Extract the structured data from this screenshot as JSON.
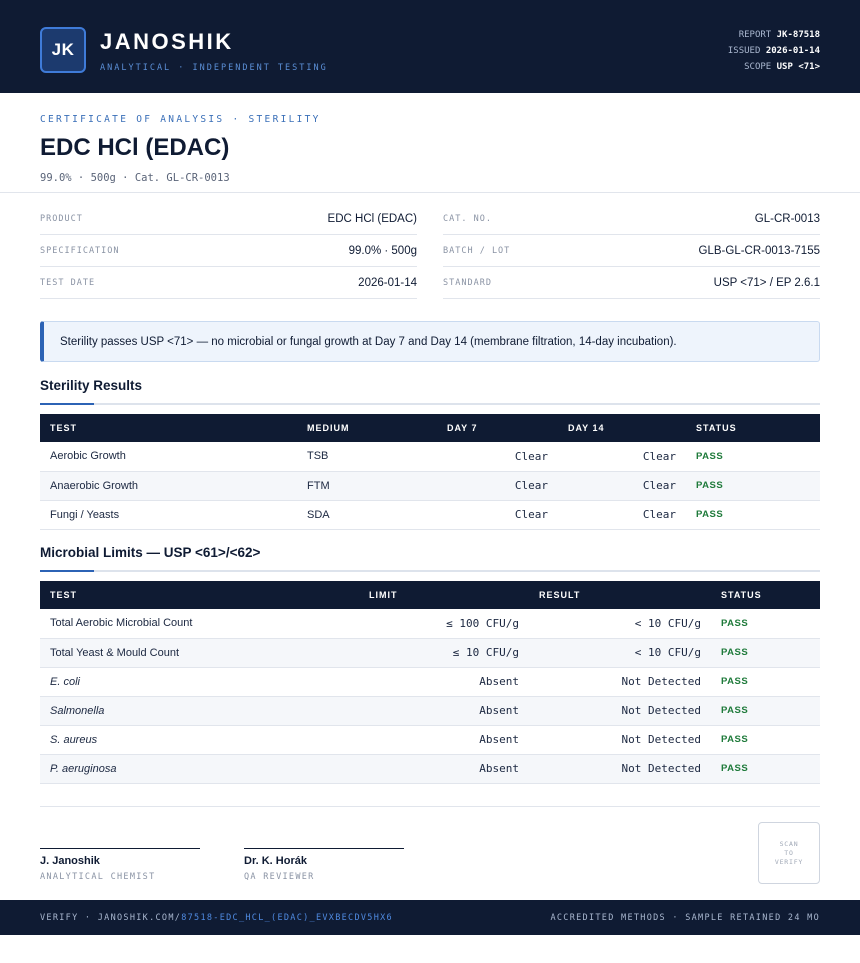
{
  "header": {
    "logo_text": "JK",
    "brand": "JANOSHIK",
    "tagline": "ANALYTICAL · INDEPENDENT TESTING",
    "report_label": "REPORT",
    "report_value": "JK-87518",
    "issued_label": "ISSUED",
    "issued_value": "2026-01-14",
    "scope_label": "SCOPE",
    "scope_value": "USP <71>"
  },
  "doc": {
    "kicker": "CERTIFICATE OF ANALYSIS · STERILITY",
    "title": "EDC HCl (EDAC)",
    "subtitle": "99.0% · 500g  ·  Cat. GL-CR-0013"
  },
  "info": {
    "left": [
      {
        "label": "PRODUCT",
        "value": "EDC HCl (EDAC)"
      },
      {
        "label": "SPECIFICATION",
        "value": "99.0% · 500g"
      },
      {
        "label": "TEST DATE",
        "value": "2026-01-14"
      }
    ],
    "right": [
      {
        "label": "CAT. NO.",
        "value": "GL-CR-0013"
      },
      {
        "label": "BATCH / LOT",
        "value": "GLB-GL-CR-0013-7155"
      },
      {
        "label": "STANDARD",
        "value": "USP <71> / EP 2.6.1"
      }
    ]
  },
  "callout": "Sterility passes USP <71> — no microbial or fungal growth at Day 7 and Day 14 (membrane filtration, 14-day incubation).",
  "sterility": {
    "title": "Sterility Results",
    "headers": [
      "TEST",
      "MEDIUM",
      "DAY 7",
      "DAY 14",
      "STATUS"
    ],
    "rows": [
      {
        "test": "Aerobic Growth",
        "medium": "TSB",
        "day7": "Clear",
        "day14": "Clear",
        "status": "PASS"
      },
      {
        "test": "Anaerobic Growth",
        "medium": "FTM",
        "day7": "Clear",
        "day14": "Clear",
        "status": "PASS"
      },
      {
        "test": "Fungi / Yeasts",
        "medium": "SDA",
        "day7": "Clear",
        "day14": "Clear",
        "status": "PASS"
      }
    ]
  },
  "microbial": {
    "title": "Microbial Limits — USP <61>/<62>",
    "headers": [
      "TEST",
      "LIMIT",
      "RESULT",
      "STATUS"
    ],
    "rows": [
      {
        "test": "Total Aerobic Microbial Count",
        "limit": "≤ 100 CFU/g",
        "result": "< 10 CFU/g",
        "status": "PASS"
      },
      {
        "test": "Total Yeast & Mould Count",
        "limit": "≤ 10 CFU/g",
        "result": "< 10 CFU/g",
        "status": "PASS"
      },
      {
        "test": "E. coli",
        "limit": "Absent",
        "result": "Not Detected",
        "status": "PASS"
      },
      {
        "test": "Salmonella",
        "limit": "Absent",
        "result": "Not Detected",
        "status": "PASS"
      },
      {
        "test": "S. aureus",
        "limit": "Absent",
        "result": "Not Detected",
        "status": "PASS"
      },
      {
        "test": "P. aeruginosa",
        "limit": "Absent",
        "result": "Not Detected",
        "status": "PASS"
      }
    ]
  },
  "signatures": [
    {
      "name": "J. Janoshik",
      "role": "ANALYTICAL CHEMIST"
    },
    {
      "name": "Dr. K. Horák",
      "role": "QA REVIEWER"
    }
  ],
  "qr_text": [
    "SCAN",
    "TO",
    "VERIFY"
  ],
  "footer": {
    "verify_prefix": "VERIFY · JANOSHIK.COM/",
    "verify_link": "87518-EDC_HCL_(EDAC)_EVXBECDV5HX6",
    "right": "ACCREDITED METHODS · SAMPLE RETAINED 24 MO"
  }
}
